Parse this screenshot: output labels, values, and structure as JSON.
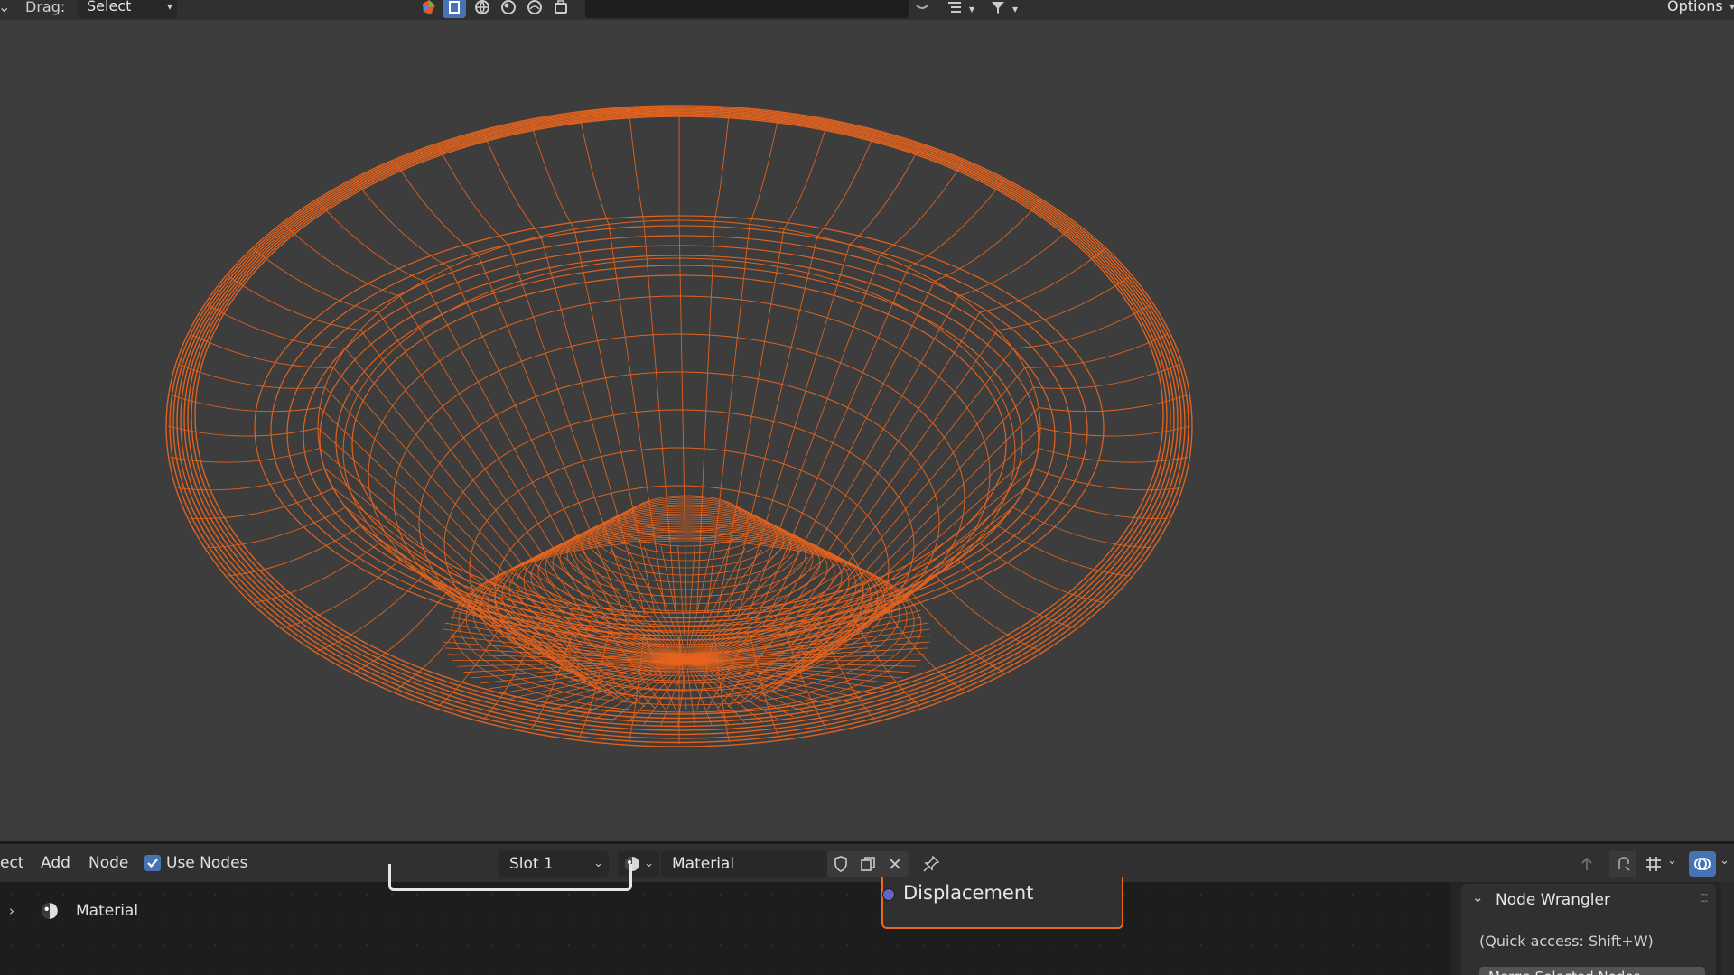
{
  "top_header": {
    "drag_label": "Drag:",
    "drag_mode": "Select Box",
    "options_label": "Options",
    "search_value": ""
  },
  "node_header": {
    "menu_select": "ect",
    "menu_add": "Add",
    "menu_node": "Node",
    "use_nodes_label": "Use Nodes",
    "use_nodes_checked": true,
    "slot": "Slot 1",
    "material_name": "Material"
  },
  "node_editor": {
    "displacement_socket": "Displacement",
    "outline_item": "Material"
  },
  "sidebar": {
    "panel_title": "Node Wrangler",
    "hint": "(Quick access: Shift+W)",
    "button_partial": "Merge Selected Nodes"
  },
  "colors": {
    "wire": "#e8641e",
    "accent": "#4772b3",
    "node_outline": "#e76b1a",
    "socket": "#6363c7"
  }
}
